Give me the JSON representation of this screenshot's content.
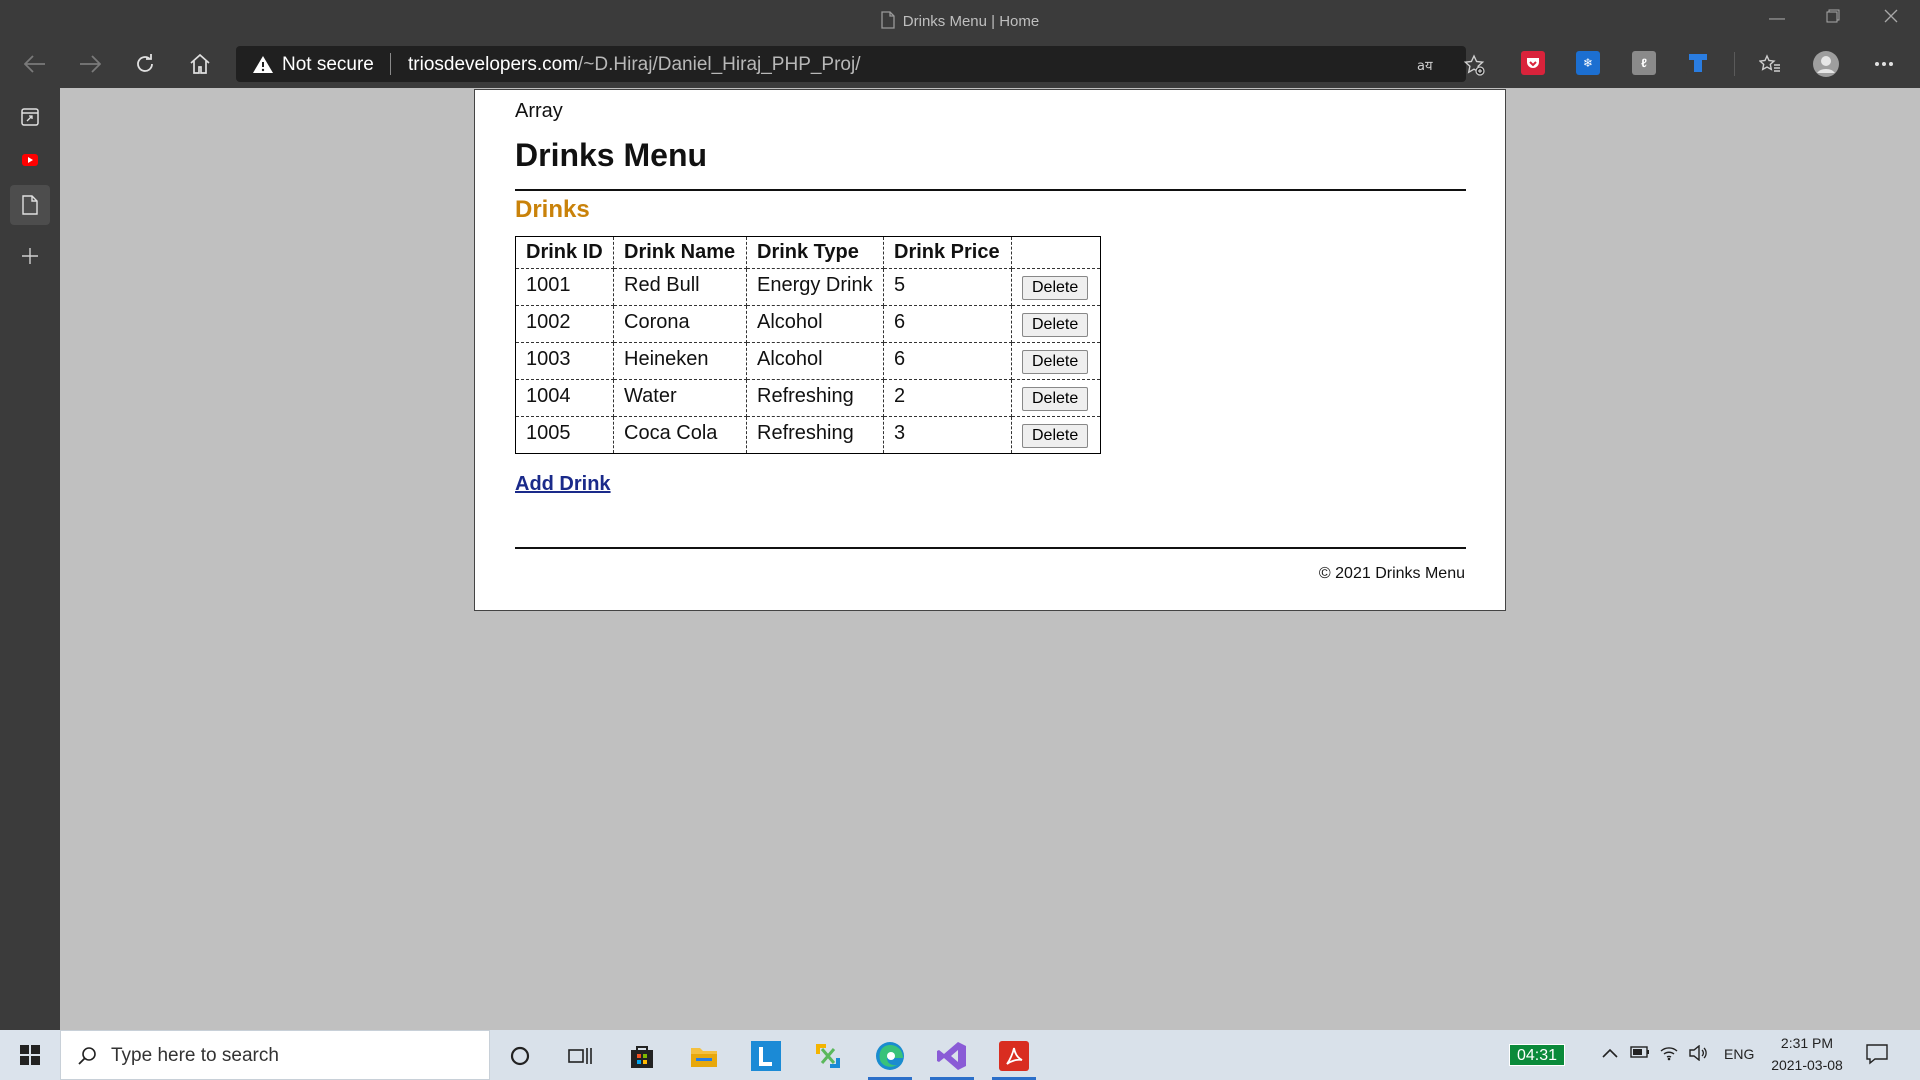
{
  "browser": {
    "tab_title": "Drinks Menu | Home",
    "security_label": "Not secure",
    "url_host": "triosdevelopers.com",
    "url_path": "/~D.Hiraj/Daniel_Hiraj_PHP_Proj/"
  },
  "page": {
    "debug_text": "Array",
    "title": "Drinks Menu",
    "section_heading": "Drinks",
    "table": {
      "headers": [
        "Drink ID",
        "Drink Name",
        "Drink Type",
        "Drink Price",
        ""
      ],
      "rows": [
        {
          "id": "1001",
          "name": "Red Bull",
          "type": "Energy Drink",
          "price": "5",
          "action": "Delete"
        },
        {
          "id": "1002",
          "name": "Corona",
          "type": "Alcohol",
          "price": "6",
          "action": "Delete"
        },
        {
          "id": "1003",
          "name": "Heineken",
          "type": "Alcohol",
          "price": "6",
          "action": "Delete"
        },
        {
          "id": "1004",
          "name": "Water",
          "type": "Refreshing",
          "price": "2",
          "action": "Delete"
        },
        {
          "id": "1005",
          "name": "Coca Cola",
          "type": "Refreshing",
          "price": "3",
          "action": "Delete"
        }
      ]
    },
    "add_link": "Add Drink",
    "footer": "© 2021 Drinks Menu"
  },
  "taskbar": {
    "search_placeholder": "Type here to search",
    "timer_widget": "04:31",
    "language": "ENG",
    "time": "2:31 PM",
    "date": "2021-03-08"
  },
  "colors": {
    "section_heading": "#c9820a",
    "link": "#1a2a8a",
    "chrome_bg": "#3b3b3b",
    "page_bg": "#c0c0c0"
  }
}
